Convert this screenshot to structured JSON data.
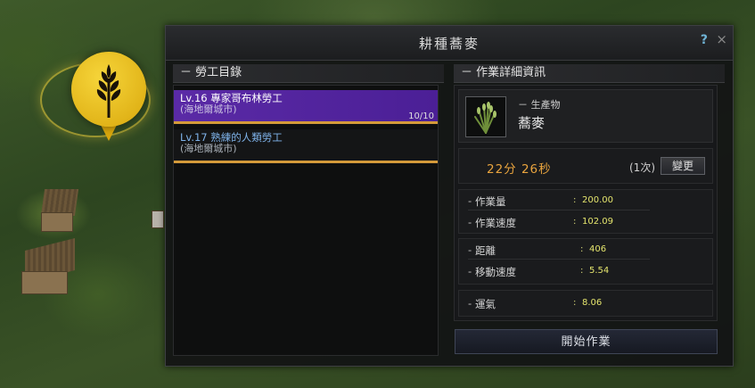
{
  "window": {
    "title": "耕種蕎麥",
    "help_label": "?",
    "close_label": "×"
  },
  "workers_section": {
    "title": "－ 勞工目錄",
    "workers": [
      {
        "name": "Lv.16 專家哥布林勞工",
        "town": "(海地爾城市)",
        "count": "10/10",
        "selected": true
      },
      {
        "name": "Lv.17 熟練的人類勞工",
        "town": "(海地爾城市)",
        "count": "",
        "selected": false
      }
    ]
  },
  "details_section": {
    "title": "－ 作業詳細資訊",
    "product": {
      "label": "－ 生產物",
      "name": "蕎麥",
      "icon": "buckwheat-icon"
    },
    "timer": "22分 26秒",
    "times": "(1次)",
    "change_label": "變更",
    "stats_group1": [
      {
        "label": "作業量",
        "value": "200.00"
      },
      {
        "label": "作業速度",
        "value": "102.09"
      }
    ],
    "stats_group2": [
      {
        "label": "距離",
        "value": "406"
      },
      {
        "label": "移動速度",
        "value": "5.54"
      }
    ],
    "stats_group3": [
      {
        "label": "運氣",
        "value": "8.06"
      }
    ]
  },
  "start_label": "開始作業",
  "map_node": {
    "icon": "wheat-node-icon"
  },
  "colors": {
    "accent_gold": "#e9a43e",
    "selected_purple": "#5a2aa6",
    "stat_value_yellow": "#e4e46d",
    "worker_name_blue": "#7fb3ea"
  }
}
